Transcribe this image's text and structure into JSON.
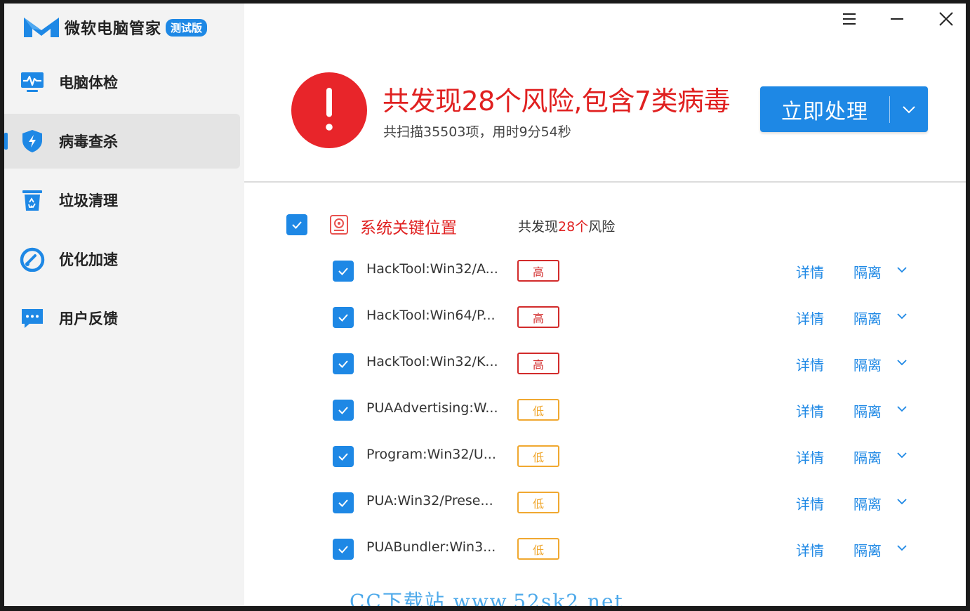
{
  "app": {
    "title": "微软电脑管家",
    "badge": "测试版"
  },
  "sidebar": {
    "items": [
      {
        "label": "电脑体检",
        "icon": "monitor-pulse-icon"
      },
      {
        "label": "病毒查杀",
        "icon": "shield-bolt-icon",
        "active": true
      },
      {
        "label": "垃圾清理",
        "icon": "recycle-bin-icon"
      },
      {
        "label": "优化加速",
        "icon": "speedometer-icon"
      },
      {
        "label": "用户反馈",
        "icon": "chat-bubble-icon"
      }
    ]
  },
  "window_controls": [
    "menu-icon",
    "minimize-icon",
    "close-icon"
  ],
  "header": {
    "title": "共发现28个风险,包含7类病毒",
    "subtitle": "共扫描35503项，用时9分54秒",
    "action_label": "立即处理"
  },
  "group": {
    "title": "系统关键位置",
    "count_prefix": "共发现",
    "count_num": "28个",
    "count_suffix": "风险"
  },
  "rows": [
    {
      "name": "HackTool:Win32/A...",
      "level": "高",
      "severity": "high",
      "detail": "详情",
      "action": "隔离"
    },
    {
      "name": "HackTool:Win64/P...",
      "level": "高",
      "severity": "high",
      "detail": "详情",
      "action": "隔离"
    },
    {
      "name": "HackTool:Win32/K...",
      "level": "高",
      "severity": "high",
      "detail": "详情",
      "action": "隔离"
    },
    {
      "name": "PUAAdvertising:W...",
      "level": "低",
      "severity": "low",
      "detail": "详情",
      "action": "隔离"
    },
    {
      "name": "Program:Win32/U...",
      "level": "低",
      "severity": "low",
      "detail": "详情",
      "action": "隔离"
    },
    {
      "name": "PUA:Win32/Prese...",
      "level": "低",
      "severity": "low",
      "detail": "详情",
      "action": "隔离"
    },
    {
      "name": "PUABundler:Win3...",
      "level": "低",
      "severity": "low",
      "detail": "详情",
      "action": "隔离"
    }
  ],
  "watermark": "CC下载站 www.52sk2.net",
  "colors": {
    "accent": "#1e88e5",
    "danger": "#e02020",
    "warning": "#f0a830",
    "sidebar_bg": "#f3f3f3"
  }
}
